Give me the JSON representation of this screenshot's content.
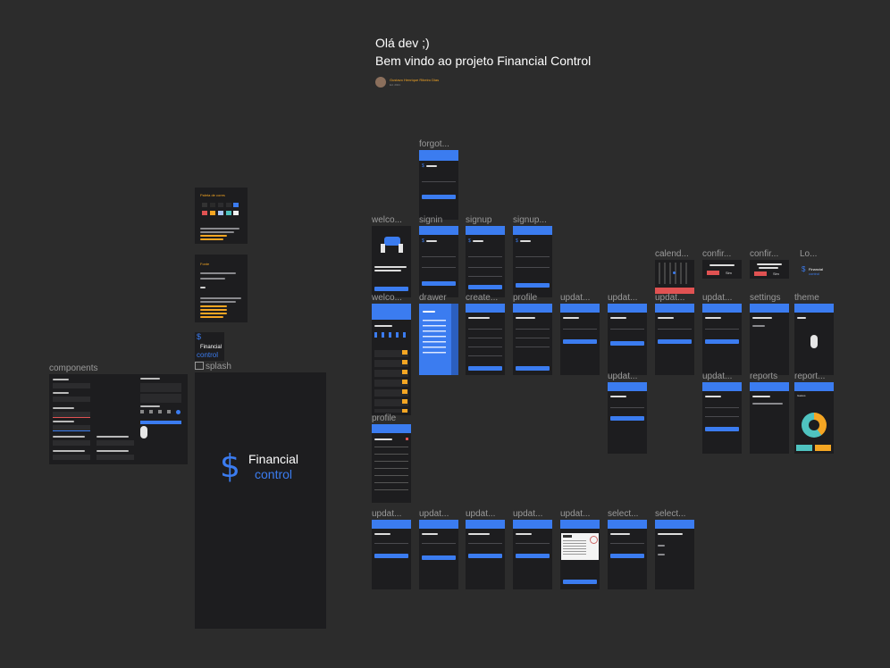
{
  "header": {
    "greeting": "Olá dev ;)",
    "welcome": "Bem vindo ao projeto Financial Control",
    "author_name": "Gustavo Henrique Ribeiro Dias",
    "author_sub": "Ed. 2021"
  },
  "labels": {
    "components": "components",
    "splash": "splash",
    "forgot": "forgot...",
    "welco1": "welco...",
    "signin": "signin",
    "signup": "signup",
    "signup2": "signup...",
    "calend": "calend...",
    "confir1": "confir...",
    "confir2": "confir...",
    "lo": "Lo...",
    "welco2": "welco...",
    "drawer": "drawer",
    "create": "create...",
    "profile_top": "profile",
    "updat_r1a": "updat...",
    "updat_r1b": "updat...",
    "updat_r1c": "updat...",
    "updat_r1d": "updat...",
    "settings": "settings",
    "theme": "theme",
    "updat_r2": "updat...",
    "updat_r2b": "updat...",
    "reports": "reports",
    "reports2": "report...",
    "profile": "profile",
    "updat_b1": "updat...",
    "updat_b2": "updat...",
    "updat_b3": "updat...",
    "updat_b4": "updat...",
    "updat_b5": "updat...",
    "select1": "select...",
    "select2": "select..."
  },
  "brand": {
    "name_top": "Financial",
    "name_bottom": "control",
    "symbol": "$",
    "accent": "#3b7cf0",
    "background": "#1d1d1f"
  },
  "style_guide": {
    "palette_title": "Paleta de cores",
    "fonts_title": "Fonte"
  },
  "welcome_screen": {
    "headline": "Mantenha suas contas de maneira eficiente",
    "button": "Entrar"
  },
  "confirm_dialog": {
    "cancel": "Não",
    "confirm": "Sim"
  },
  "reports_chart": {
    "title": "Gastos",
    "colors": [
      "#f5a623",
      "#4fc3c0"
    ]
  }
}
